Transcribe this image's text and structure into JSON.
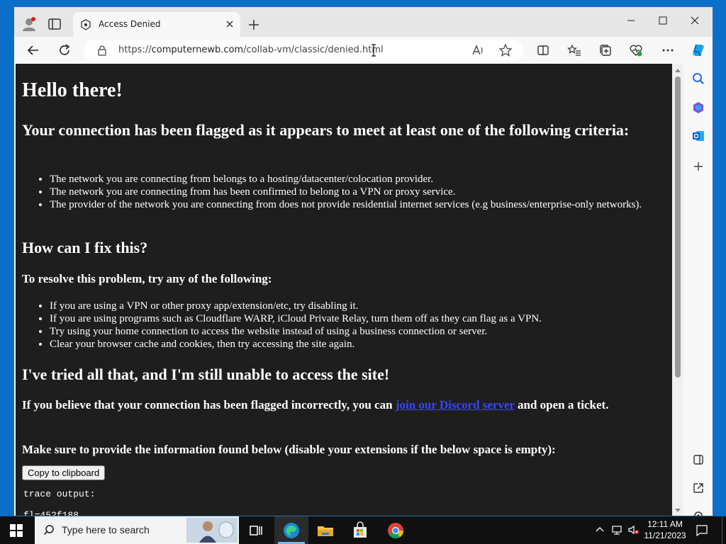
{
  "browser": {
    "tab_title": "Access Denied",
    "url_scheme": "https://",
    "url_host": "computernewb.com",
    "url_path": "/collab-vm/classic/denied.html"
  },
  "page": {
    "heading": "Hello there!",
    "flagged_heading": "Your connection has been flagged as it appears to meet at least one of the following criteria:",
    "criteria": [
      "The network you are connecting from belongs to a hosting/datacenter/colocation provider.",
      "The network you are connecting from has been confirmed to belong to a VPN or proxy service.",
      "The provider of the network you are connecting from does not provide residential internet services (e.g business/enterprise-only networks)."
    ],
    "fix_heading": "How can I fix this?",
    "resolve_heading": "To resolve this problem, try any of the following:",
    "fixes": [
      "If you are using a VPN or other proxy app/extension/etc, try disabling it.",
      "If you are using programs such as Cloudflare WARP, iCloud Private Relay, turn them off as they can flag as a VPN.",
      "Try using your home connection to access the website instead of using a business connection or server.",
      "Clear your browser cache and cookies, then try accessing the site again."
    ],
    "tried_heading": "I've tried all that, and I'm still unable to access the site!",
    "believe_prefix": "If you believe that your connection has been flagged incorrectly, you can ",
    "discord_link": "join our Discord server",
    "believe_suffix": " and open a ticket.",
    "provide_heading": "Make sure to provide the information found below (disable your extensions if the below space is empty):",
    "copy_button": "Copy to clipboard",
    "trace_label": "trace output:",
    "trace_first_line": "fl=452f188"
  },
  "taskbar": {
    "search_placeholder": "Type here to search",
    "time": "12:11 AM",
    "date": "11/21/2023"
  },
  "colors": {
    "page_bg": "#1e1e1e",
    "link": "#3a44ff",
    "taskbar": "#101010",
    "desktop": "#0078d7"
  }
}
